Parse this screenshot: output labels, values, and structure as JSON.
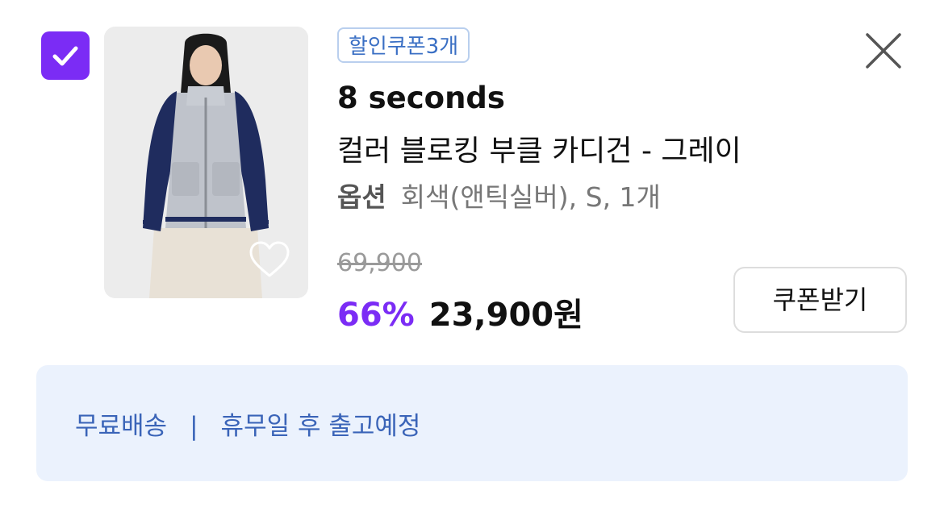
{
  "product": {
    "coupon_badge": "할인쿠폰3개",
    "brand": "8 seconds",
    "name": "컬러 블로킹 부클 카디건 - 그레이",
    "option_label": "옵션",
    "option_value": "회색(앤틱실버), S, 1개",
    "original_price": "69,900",
    "discount_rate": "66%",
    "final_price": "23,900원",
    "coupon_button": "쿠폰받기",
    "image_icon": "product-photo",
    "wishlist_icon": "heart-icon"
  },
  "delivery": {
    "shipping": "무료배송",
    "separator": "|",
    "schedule": "휴무일 후 출고예정"
  },
  "colors": {
    "accent": "#7b2cf5",
    "badge_border": "#b9cfee",
    "badge_text": "#3a6fc4",
    "delivery_bg": "#ebf2fd",
    "delivery_text": "#3a64b8"
  },
  "icons": {
    "checkbox": "checkmark-icon",
    "close": "close-icon"
  }
}
